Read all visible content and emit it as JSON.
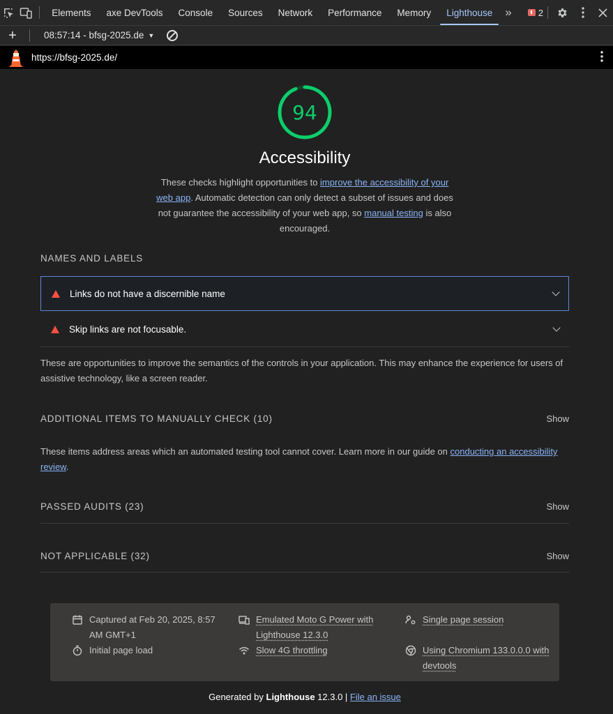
{
  "devtools": {
    "tabs": [
      "Elements",
      "axe DevTools",
      "Console",
      "Sources",
      "Network",
      "Performance",
      "Memory",
      "Lighthouse"
    ],
    "active_tab": "Lighthouse",
    "issues_count": "2"
  },
  "toolbar": {
    "report_label": "08:57:14 - bfsg-2025.de"
  },
  "urlbar": {
    "url": "https://bfsg-2025.de/"
  },
  "category": {
    "score": "94",
    "score_color": "#0cce6b",
    "score_fraction": 0.94,
    "title": "Accessibility",
    "desc_1": "These checks highlight opportunities to ",
    "desc_link_1": "improve the accessibility of your web app",
    "desc_2": ". Automatic detection can only detect a subset of issues and does not guarantee the accessibility of your web app, so ",
    "desc_link_2": "manual testing",
    "desc_3": " is also encouraged."
  },
  "names_labels": {
    "title": "NAMES AND LABELS",
    "audits": [
      "Links do not have a discernible name",
      "Skip links are not focusable."
    ],
    "description": "These are opportunities to improve the semantics of the controls in your application. This may enhance the experience for users of assistive technology, like a screen reader."
  },
  "manual": {
    "title": "ADDITIONAL ITEMS TO MANUALLY CHECK (10)",
    "show": "Show",
    "description": "These items address areas which an automated testing tool cannot cover. Learn more in our guide on ",
    "link": "conducting an accessibility review",
    "end": "."
  },
  "passed": {
    "title": "PASSED AUDITS (23)",
    "show": "Show"
  },
  "not_applicable": {
    "title": "NOT APPLICABLE (32)",
    "show": "Show"
  },
  "meta": {
    "captured": "Captured at Feb 20, 2025, 8:57 AM GMT+1",
    "load": "Initial page load",
    "device": "Emulated Moto G Power with Lighthouse 12.3.0",
    "throttle": "Slow 4G throttling",
    "session": "Single page session",
    "browser": "Using Chromium 133.0.0.0 with devtools"
  },
  "footer": {
    "generated_by": "Generated by ",
    "product": "Lighthouse",
    "version": " 12.3.0 | ",
    "issue_link": "File an issue"
  }
}
